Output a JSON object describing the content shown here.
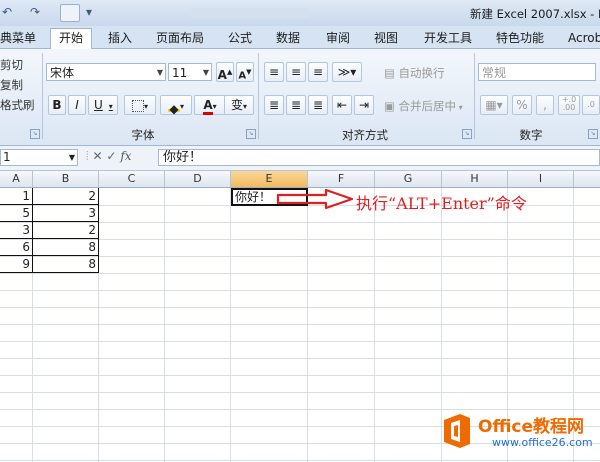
{
  "titlebar": {
    "title": "新建 Excel 2007.xlsx - Mic",
    "quick_access": [
      "↶",
      "↷",
      "▾"
    ]
  },
  "tabs": [
    {
      "label": "典菜单"
    },
    {
      "label": "开始"
    },
    {
      "label": "插入"
    },
    {
      "label": "页面布局"
    },
    {
      "label": "公式"
    },
    {
      "label": "数据"
    },
    {
      "label": "审阅"
    },
    {
      "label": "视图"
    },
    {
      "label": "开发工具"
    },
    {
      "label": "特色功能"
    },
    {
      "label": "Acrob"
    }
  ],
  "clipboard": {
    "cut": "剪切",
    "copy": "复制",
    "format_painter": "格式刷"
  },
  "font_group": {
    "label": "字体",
    "font_name": "宋体",
    "font_size": "11",
    "grow": "A",
    "shrink": "A",
    "bold": "B",
    "italic": "I",
    "underline": "U",
    "font_color": "A",
    "phonetic": "变"
  },
  "align_group": {
    "label": "对齐方式",
    "wrap_text": "自动换行",
    "merge_center": "合并后居中"
  },
  "number_group": {
    "label": "数字",
    "format": "常规",
    "percent": "%",
    "comma": ",",
    "increase_decimal": "+.0\n.00"
  },
  "formula_bar": {
    "name_box": "1",
    "fx": "fx",
    "content": "你好！"
  },
  "columns": [
    "A",
    "B",
    "C",
    "D",
    "E",
    "F",
    "G",
    "H",
    "I"
  ],
  "rows": [
    {
      "a": "1",
      "b": "2"
    },
    {
      "a": "5",
      "b": "3"
    },
    {
      "a": "3",
      "b": "2"
    },
    {
      "a": "6",
      "b": "8"
    },
    {
      "a": "9",
      "b": "8"
    }
  ],
  "active_cell": {
    "value": "你好！"
  },
  "annotation": "执行“ALT+Enter”命令",
  "watermark": {
    "line1": "Office教程网",
    "line2": "www.office26.com"
  },
  "colors": {
    "annotation": "#e02020",
    "selected_col": "#f3b95c",
    "watermark_orange": "#f06a00"
  }
}
